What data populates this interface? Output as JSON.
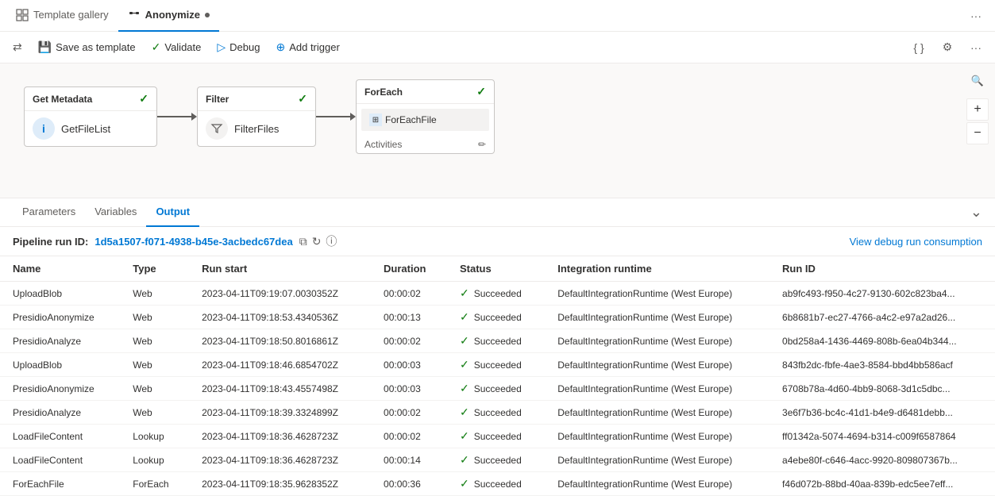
{
  "tabs": [
    {
      "id": "template-gallery",
      "label": "Template gallery",
      "active": false
    },
    {
      "id": "anonymize",
      "label": "Anonymize",
      "active": true,
      "dot": true
    }
  ],
  "toolbar": {
    "save_label": "Save as template",
    "validate_label": "Validate",
    "debug_label": "Debug",
    "trigger_label": "Add trigger"
  },
  "canvas": {
    "nodes": [
      {
        "id": "get-metadata",
        "header": "Get Metadata",
        "icon": "i",
        "icon_type": "blue",
        "label": "GetFileList"
      },
      {
        "id": "filter",
        "header": "Filter",
        "icon_type": "gray",
        "label": "FilterFiles"
      },
      {
        "id": "foreach",
        "header": "ForEach",
        "inner_label": "ForEachFile",
        "activities_label": "Activities"
      }
    ]
  },
  "output_panel": {
    "tabs": [
      {
        "label": "Parameters",
        "active": false
      },
      {
        "label": "Variables",
        "active": false
      },
      {
        "label": "Output",
        "active": true
      }
    ],
    "run_id_label": "Pipeline run ID:",
    "run_id_value": "1d5a1507-f071-4938-b45e-3acbedc67dea",
    "debug_link": "View debug run consumption",
    "table": {
      "columns": [
        "Name",
        "Type",
        "Run start",
        "Duration",
        "Status",
        "Integration runtime",
        "Run ID"
      ],
      "rows": [
        {
          "name": "UploadBlob",
          "type": "Web",
          "run_start": "2023-04-11T09:19:07.0030352Z",
          "duration": "00:00:02",
          "status": "Succeeded",
          "runtime": "DefaultIntegrationRuntime (West Europe)",
          "run_id": "ab9fc493-f950-4c27-9130-602c823ba4..."
        },
        {
          "name": "PresidioAnonymize",
          "type": "Web",
          "run_start": "2023-04-11T09:18:53.4340536Z",
          "duration": "00:00:13",
          "status": "Succeeded",
          "runtime": "DefaultIntegrationRuntime (West Europe)",
          "run_id": "6b8681b7-ec27-4766-a4c2-e97a2ad26..."
        },
        {
          "name": "PresidioAnalyze",
          "type": "Web",
          "run_start": "2023-04-11T09:18:50.8016861Z",
          "duration": "00:00:02",
          "status": "Succeeded",
          "runtime": "DefaultIntegrationRuntime (West Europe)",
          "run_id": "0bd258a4-1436-4469-808b-6ea04b344..."
        },
        {
          "name": "UploadBlob",
          "type": "Web",
          "run_start": "2023-04-11T09:18:46.6854702Z",
          "duration": "00:00:03",
          "status": "Succeeded",
          "runtime": "DefaultIntegrationRuntime (West Europe)",
          "run_id": "843fb2dc-fbfe-4ae3-8584-bbd4bb586acf"
        },
        {
          "name": "PresidioAnonymize",
          "type": "Web",
          "run_start": "2023-04-11T09:18:43.4557498Z",
          "duration": "00:00:03",
          "status": "Succeeded",
          "runtime": "DefaultIntegrationRuntime (West Europe)",
          "run_id": "6708b78a-4d60-4bb9-8068-3d1c5dbc..."
        },
        {
          "name": "PresidioAnalyze",
          "type": "Web",
          "run_start": "2023-04-11T09:18:39.3324899Z",
          "duration": "00:00:02",
          "status": "Succeeded",
          "runtime": "DefaultIntegrationRuntime (West Europe)",
          "run_id": "3e6f7b36-bc4c-41d1-b4e9-d6481debb..."
        },
        {
          "name": "LoadFileContent",
          "type": "Lookup",
          "run_start": "2023-04-11T09:18:36.4628723Z",
          "duration": "00:00:02",
          "status": "Succeeded",
          "runtime": "DefaultIntegrationRuntime (West Europe)",
          "run_id": "ff01342a-5074-4694-b314-c009f6587864"
        },
        {
          "name": "LoadFileContent",
          "type": "Lookup",
          "run_start": "2023-04-11T09:18:36.4628723Z",
          "duration": "00:00:14",
          "status": "Succeeded",
          "runtime": "DefaultIntegrationRuntime (West Europe)",
          "run_id": "a4ebe80f-c646-4acc-9920-809807367b..."
        },
        {
          "name": "ForEachFile",
          "type": "ForEach",
          "run_start": "2023-04-11T09:18:35.9628352Z",
          "duration": "00:00:36",
          "status": "Succeeded",
          "runtime": "DefaultIntegrationRuntime (West Europe)",
          "run_id": "f46d072b-88bd-40aa-839b-edc5ee7eff..."
        }
      ]
    }
  }
}
